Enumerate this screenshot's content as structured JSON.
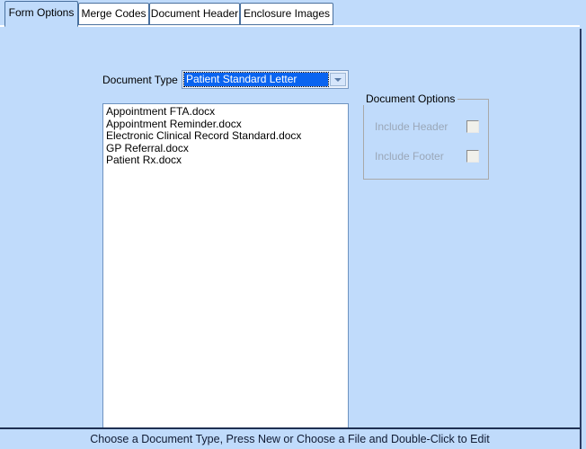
{
  "tabs": [
    {
      "label": "Form Options",
      "active": true
    },
    {
      "label": "Merge Codes",
      "active": false
    },
    {
      "label": "Document Header",
      "active": false
    },
    {
      "label": "Enclosure Images",
      "active": false
    }
  ],
  "form": {
    "document_type_label": "Document Type",
    "document_type_value": "Patient Standard Letter",
    "dropdown_icon": "chevron-down-icon"
  },
  "file_list": [
    "Appointment FTA.docx",
    "Appointment Reminder.docx",
    "Electronic Clinical Record Standard.docx",
    "GP Referral.docx",
    "Patient Rx.docx"
  ],
  "document_options": {
    "title": "Document Options",
    "items": [
      {
        "label": "Include Header",
        "checked": false,
        "enabled": false
      },
      {
        "label": "Include Footer",
        "checked": false,
        "enabled": false
      }
    ]
  },
  "status_bar": {
    "message": "Choose a Document Type, Press New or Choose a File and Double-Click to Edit"
  },
  "colors": {
    "window_background": "#c0dbfb",
    "tab_inactive": "#ffffff",
    "selection_blue": "#0a64f0",
    "listbox_background": "#ffffff",
    "disabled_text": "#9aa7b8",
    "border": "#7a9bc4"
  }
}
